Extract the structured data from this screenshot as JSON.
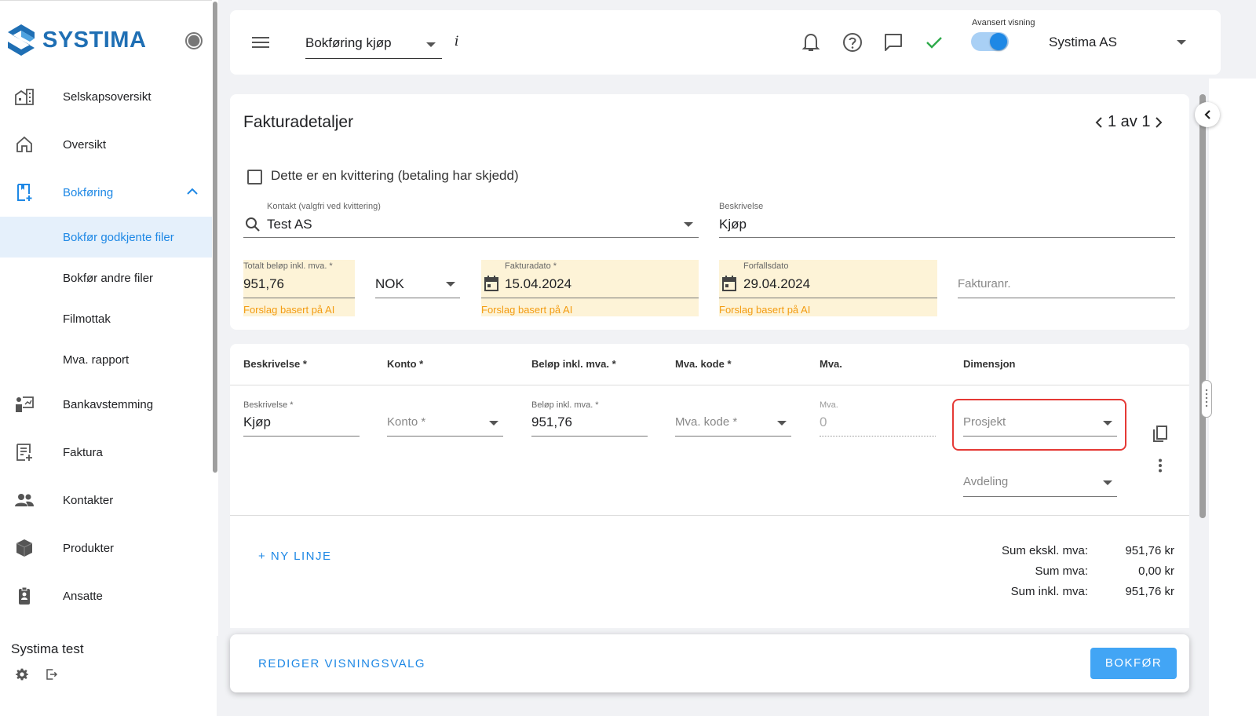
{
  "app": {
    "brand": "SYSTIMA"
  },
  "sidebar": {
    "items": [
      {
        "label": "Selskapsoversikt",
        "icon": "company-overview-icon"
      },
      {
        "label": "Oversikt",
        "icon": "home-icon"
      },
      {
        "label": "Bokføring",
        "icon": "bookkeeping-icon"
      },
      {
        "label": "Bokfør godkjente filer"
      },
      {
        "label": "Bokfør andre filer"
      },
      {
        "label": "Filmottak"
      },
      {
        "label": "Mva. rapport"
      },
      {
        "label": "Bankavstemming",
        "icon": "bank-reconciliation-icon"
      },
      {
        "label": "Faktura",
        "icon": "invoice-icon"
      },
      {
        "label": "Kontakter",
        "icon": "contacts-icon"
      },
      {
        "label": "Produkter",
        "icon": "products-icon"
      },
      {
        "label": "Ansatte",
        "icon": "employees-icon"
      }
    ],
    "company_name": "Systima test"
  },
  "topbar": {
    "module": "Bokføring kjøp",
    "info": "i",
    "advanced_view_label": "Avansert visning",
    "advanced_view_on": true,
    "company": "Systima AS"
  },
  "invoice": {
    "title": "Fakturadetaljer",
    "pager": "1 av 1",
    "receipt_checkbox_label": "Dette er en kvittering (betaling har skjedd)",
    "contact_label": "Kontakt (valgfri ved kvittering)",
    "contact_value": "Test AS",
    "description_label": "Beskrivelse",
    "description_value": "Kjøp",
    "total_label": "Totalt beløp inkl. mva. *",
    "total_value": "951,76",
    "currency": "NOK",
    "invoice_date_label": "Fakturadato *",
    "invoice_date_value": "15.04.2024",
    "due_date_label": "Forfallsdato",
    "due_date_value": "29.04.2024",
    "invoice_no_placeholder": "Fakturanr.",
    "ai_hint": "Forslag basert på AI"
  },
  "lines": {
    "headers": [
      "Beskrivelse *",
      "Konto *",
      "Beløp inkl. mva. *",
      "Mva. kode *",
      "Mva.",
      "Dimensjon"
    ],
    "row": {
      "desc_label": "Beskrivelse *",
      "desc_value": "Kjøp",
      "account_placeholder": "Konto *",
      "amount_label": "Beløp inkl. mva. *",
      "amount_value": "951,76",
      "vat_code_placeholder": "Mva. kode *",
      "vat_label": "Mva.",
      "vat_value": "0",
      "project_placeholder": "Prosjekt",
      "department_placeholder": "Avdeling"
    },
    "new_line": "+ NY LINJE",
    "sums": [
      {
        "label": "Sum ekskl. mva:",
        "value": "951,76 kr"
      },
      {
        "label": "Sum mva:",
        "value": "0,00 kr"
      },
      {
        "label": "Sum inkl. mva:",
        "value": "951,76 kr"
      }
    ]
  },
  "footer": {
    "edit_view": "REDIGER VISNINGSVALG",
    "submit": "BOKFØR"
  },
  "colors": {
    "accent": "#1e88e5",
    "ai_highlight": "#fdf3d7",
    "ai_hint": "#f39c12",
    "highlight_box": "#e53935"
  }
}
